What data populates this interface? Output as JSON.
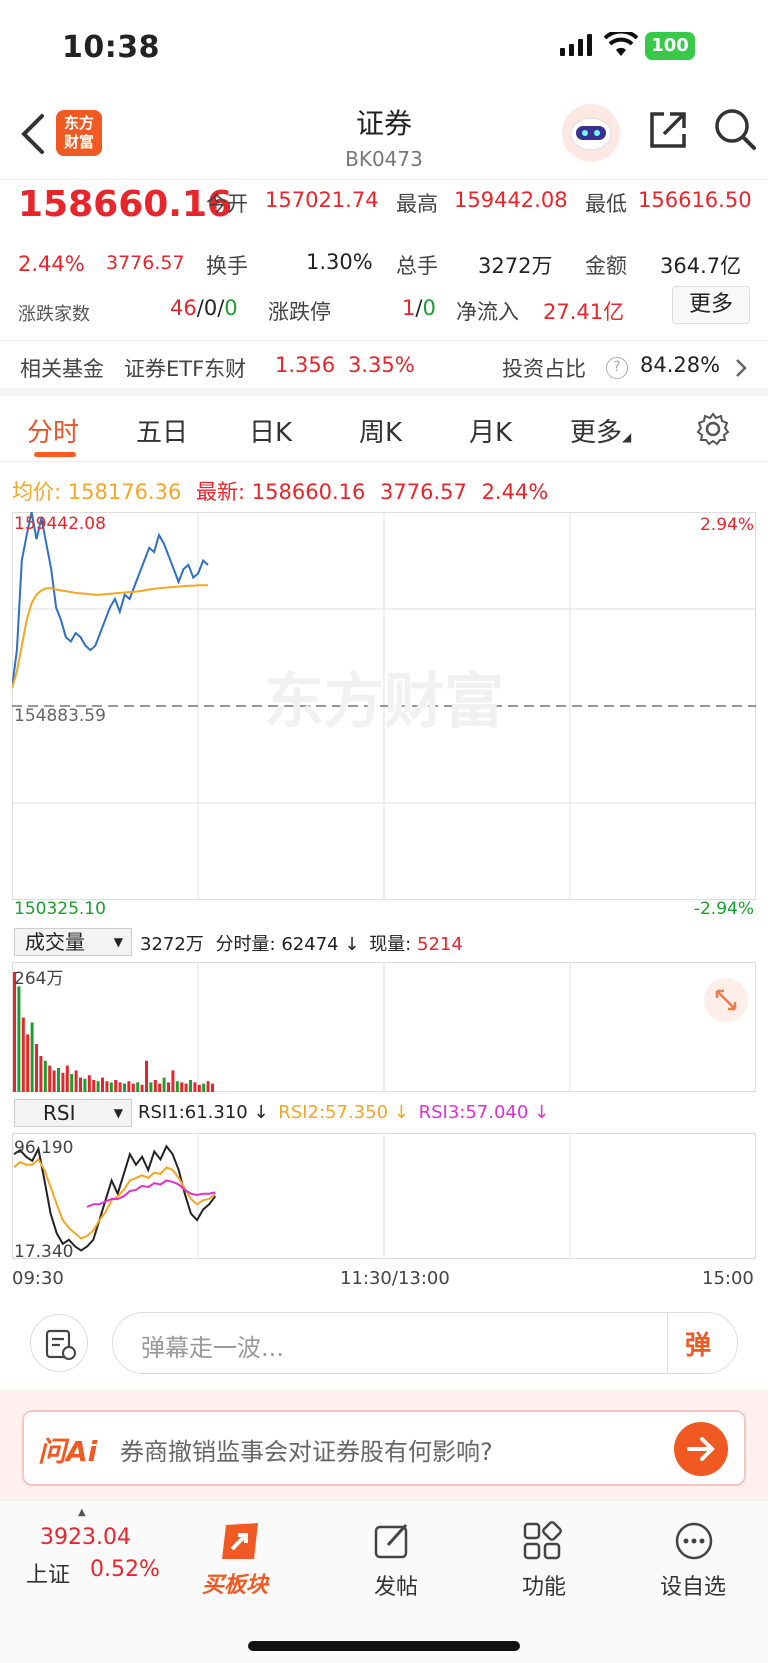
{
  "status": {
    "time": "10:38",
    "battery": "100"
  },
  "nav": {
    "title": "证券",
    "code": "BK0473",
    "logo_line1": "东方",
    "logo_line2": "财富"
  },
  "quote": {
    "price": "158660.16",
    "change_pct": "2.44%",
    "change": "3776.57",
    "open_label": "今开",
    "open": "157021.74",
    "high_label": "最高",
    "high": "159442.08",
    "low_label": "最低",
    "low": "156616.50",
    "turnover_label": "换手",
    "turnover": "1.30%",
    "volume_label": "总手",
    "volume": "3272万",
    "amount_label": "金额",
    "amount": "364.7亿",
    "updown_label": "涨跌家数",
    "up": "46",
    "flat": "0",
    "down": "0",
    "limit_label": "涨跌停",
    "limit_up": "1",
    "limit_down": "0",
    "inflow_label": "净流入",
    "inflow": "27.41亿",
    "more_label": "更多"
  },
  "fund": {
    "label": "相关基金",
    "name": "证券ETF东财",
    "price": "1.356",
    "pct": "3.35%",
    "ratio_label": "投资占比",
    "ratio": "84.28%"
  },
  "tabs": [
    "分时",
    "五日",
    "日K",
    "周K",
    "月K",
    "更多"
  ],
  "chart_info": {
    "avg_label": "均价:",
    "avg": "158176.36",
    "latest_label": "最新:",
    "latest": "158660.16",
    "chg": "3776.57",
    "pct": "2.44%"
  },
  "chart_data": {
    "type": "line",
    "price_top": "159442.08",
    "price_mid": "154883.59",
    "price_bot": "150325.10",
    "pct_top": "2.94%",
    "pct_bot": "-2.94%",
    "ylim": [
      150325.1,
      159442.08
    ],
    "x_labels": [
      "09:30",
      "11:30/13:00",
      "15:00"
    ],
    "watermark": "东方财富",
    "series": [
      {
        "color": "#2f6fc6",
        "values": [
          155300,
          156200,
          158300,
          158900,
          159442,
          158800,
          159300,
          158700,
          158100,
          157200,
          156900,
          156500,
          156400,
          156600,
          156500,
          156300,
          156200,
          156300,
          156600,
          156900,
          157200,
          157400,
          157100,
          157500,
          157400,
          157700,
          158000,
          158300,
          158600,
          158500,
          158900,
          158700,
          158400,
          158100,
          157800,
          158100,
          158200,
          157900,
          158000,
          158300,
          158200
        ]
      },
      {
        "color": "#f5a623",
        "values": [
          155300,
          155700,
          156300,
          156900,
          157300,
          157500,
          157600,
          157650,
          157650,
          157620,
          157600,
          157580,
          157560,
          157540,
          157530,
          157520,
          157510,
          157500,
          157500,
          157510,
          157520,
          157530,
          157540,
          157550,
          157560,
          157570,
          157580,
          157600,
          157620,
          157640,
          157650,
          157660,
          157670,
          157680,
          157690,
          157700,
          157710,
          157710,
          157720,
          157720,
          157720
        ]
      }
    ],
    "volume": {
      "selector": "成交量",
      "total": "3272万",
      "fen_label": "分时量:",
      "fen": "62474",
      "xian_label": "现量:",
      "xian": "5214",
      "max_label": "264万",
      "bars": [
        100,
        88,
        62,
        48,
        58,
        40,
        30,
        26,
        22,
        18,
        20,
        16,
        22,
        15,
        18,
        12,
        11,
        14,
        10,
        9,
        12,
        9,
        8,
        10,
        8,
        7,
        9,
        7,
        8,
        6,
        26,
        8,
        10,
        7,
        12,
        8,
        18,
        9,
        8,
        7,
        10,
        8,
        6,
        7,
        9,
        7
      ]
    },
    "rsi": {
      "selector": "RSI",
      "rsi1": "RSI1:61.310",
      "rsi2": "RSI2:57.350",
      "rsi3": "RSI3:57.040",
      "top": "96.190",
      "bot": "17.340",
      "series": [
        {
          "color": "#222222",
          "values": [
            90,
            93,
            88,
            85,
            94,
            70,
            45,
            30,
            22,
            25,
            20,
            17,
            20,
            25,
            40,
            55,
            70,
            60,
            75,
            90,
            82,
            88,
            78,
            92,
            86,
            96,
            90,
            78,
            60,
            45,
            40,
            48,
            52,
            58
          ]
        },
        {
          "color": "#f5a623",
          "values": [
            80,
            84,
            82,
            82,
            86,
            78,
            65,
            52,
            40,
            34,
            30,
            26,
            28,
            32,
            40,
            46,
            55,
            58,
            63,
            70,
            72,
            74,
            72,
            76,
            75,
            80,
            78,
            72,
            64,
            56,
            52,
            55,
            56,
            60
          ]
        },
        {
          "color": "#e030d0",
          "values": [
            null,
            null,
            null,
            null,
            null,
            null,
            null,
            null,
            null,
            null,
            null,
            null,
            50,
            52,
            52,
            54,
            56,
            56,
            58,
            62,
            63,
            66,
            65,
            68,
            67,
            70,
            69,
            67,
            63,
            60,
            59,
            60,
            60,
            61
          ]
        }
      ]
    }
  },
  "input": {
    "placeholder": "弹幕走一波...",
    "send_label": "弹"
  },
  "ai": {
    "brand": "问Ai",
    "question": "券商撤销监事会对证券股有何影响?"
  },
  "tabbar": {
    "index_value": "3923.04",
    "index_name": "上证",
    "index_pct": "0.52%",
    "items": [
      "买板块",
      "发帖",
      "功能",
      "设自选"
    ]
  }
}
